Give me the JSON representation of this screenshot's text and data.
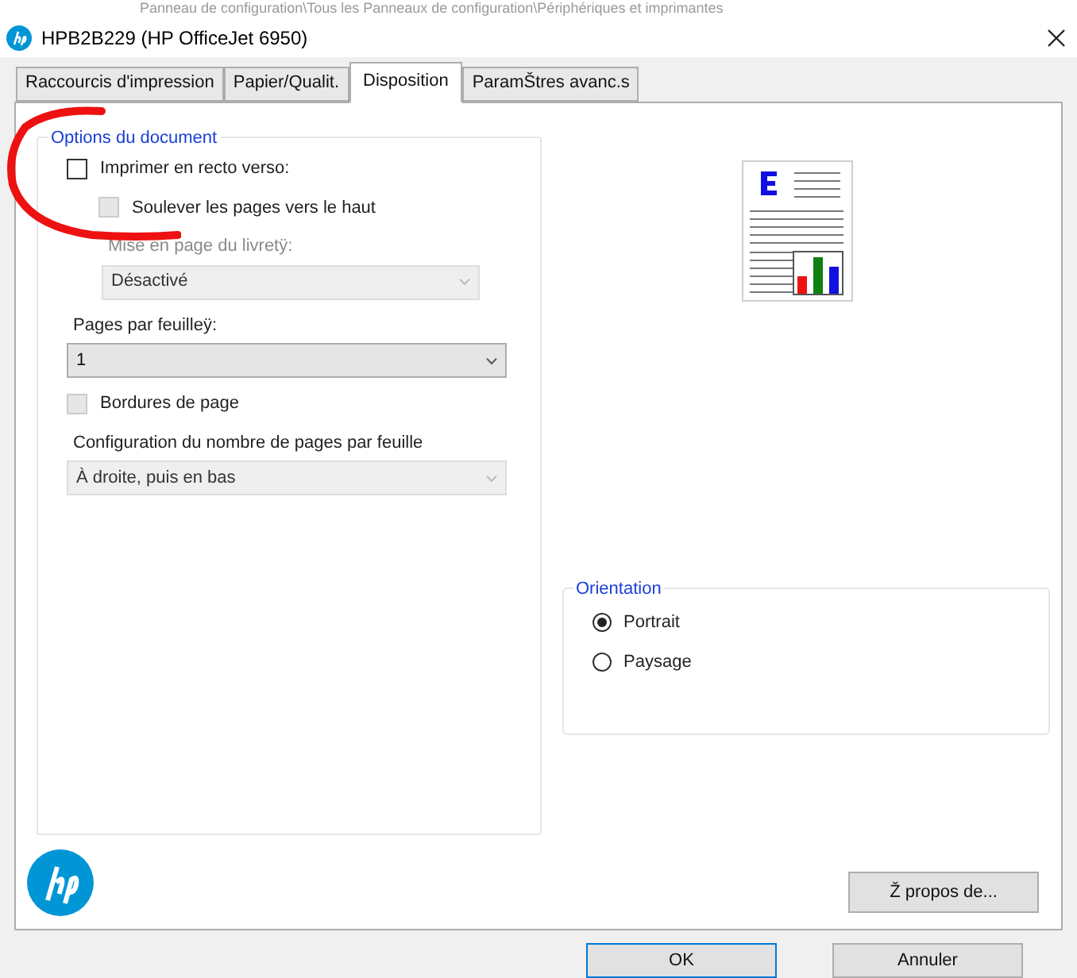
{
  "background_path": "Panneau de configuration\\Tous les Panneaux de configuration\\Périphériques et imprimantes",
  "window": {
    "title": "HPB2B229 (HP OfficeJet 6950)"
  },
  "tabs": [
    {
      "label": "Raccourcis d'impression",
      "selected": false
    },
    {
      "label": "Papier/Qualit.",
      "selected": false
    },
    {
      "label": "Disposition",
      "selected": true
    },
    {
      "label": "ParamŠtres avanc.s",
      "selected": false
    }
  ],
  "document_options": {
    "title": "Options du document",
    "items": [
      {
        "kind": "checkbox",
        "label": "Imprimer en recto verso:",
        "checked": false,
        "disabled": false,
        "indented": false
      },
      {
        "kind": "checkbox",
        "label": "Soulever les pages vers le haut",
        "checked": false,
        "disabled": true,
        "indented": true
      },
      {
        "kind": "select",
        "label": "Mise en page du livretÿ:",
        "value": "Désactivé",
        "disabled": true,
        "indented": true
      },
      {
        "kind": "select",
        "label": "Pages par feuilleÿ:",
        "value": "1",
        "disabled": false,
        "indented": false
      },
      {
        "kind": "checkbox",
        "label": "Bordures de page",
        "checked": false,
        "disabled": true,
        "indented": false
      },
      {
        "kind": "select",
        "label": "Configuration du nombre de pages par feuille",
        "value": "À droite, puis en bas",
        "disabled": true,
        "indented": false
      }
    ]
  },
  "orientation": {
    "title": "Orientation",
    "options": [
      {
        "label": "Portrait",
        "selected": true
      },
      {
        "label": "Paysage",
        "selected": false
      }
    ]
  },
  "about_button": "Ž propos de...",
  "buttons": [
    {
      "label": "OK",
      "default": true
    },
    {
      "label": "Annuler",
      "default": false
    }
  ]
}
